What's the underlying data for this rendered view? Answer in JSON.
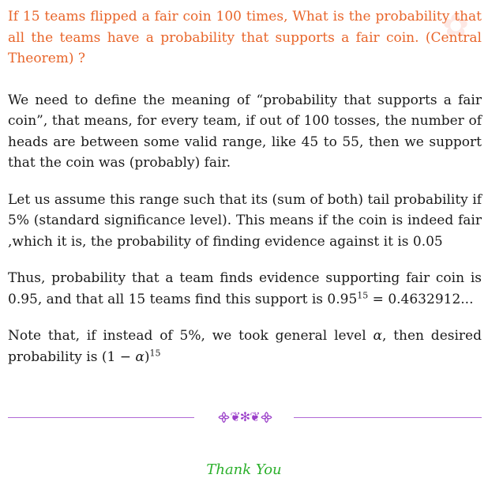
{
  "question": {
    "text": "If 15 teams flipped a fair coin 100 times, What is the probability that all the teams have a probability that supports a fair coin. (Central Theorem) ?"
  },
  "answer": {
    "para1": "We need to define the meaning of “probability that supports a fair coin”, that means, for every team, if out of 100 tosses, the number of heads are between some valid range, like 45 to 55, then we support that the coin was (probably) fair.",
    "para2": "Let us assume this range such that its (sum of both) tail probability if 5% (standard significance level). This means if the coin is indeed fair ,which it is, the probability of finding evidence against it is 0.05",
    "para3_a": "Thus, probability that a team finds evidence supporting fair coin is 0.95, and that all 15 teams find this support is 0.95",
    "para3_exp": "15",
    "para3_b": " = 0.4632912...",
    "para4_a": "Note that, if instead of 5%, we took general level ",
    "para4_alpha": "α",
    "para4_b": ", then desired probability is (1 − ",
    "para4_alpha2": "α",
    "para4_c": ")",
    "para4_exp": "15"
  },
  "footer": {
    "ornament": "᯽❦✻❦᯽",
    "thanks": "Thank You"
  },
  "colors": {
    "question": "#e8652a",
    "rule": "#b06ad6",
    "ornament": "#9b3fc9",
    "thanks": "#2bb02b"
  }
}
